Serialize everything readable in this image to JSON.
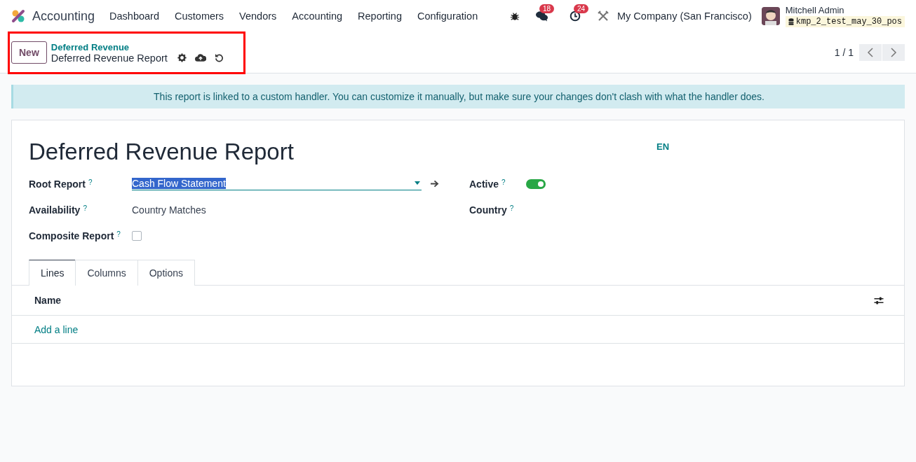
{
  "navbar": {
    "app": "Accounting",
    "menu": [
      "Dashboard",
      "Customers",
      "Vendors",
      "Accounting",
      "Reporting",
      "Configuration"
    ],
    "messages_count": "18",
    "activities_count": "24",
    "company": "My Company (San Francisco)",
    "user": "Mitchell Admin",
    "database": "kmp_2_test_may_30_pos"
  },
  "control_panel": {
    "new_button": "New",
    "breadcrumb_parent": "Deferred Revenue",
    "breadcrumb_current": "Deferred Revenue Report",
    "highlighted": true,
    "pager": "1 / 1"
  },
  "alert": "This report is linked to a custom handler. You can customize it manually, but make sure your changes don't clash with what the handler does.",
  "form": {
    "title": "Deferred Revenue Report",
    "language": "EN",
    "left_fields": [
      {
        "label": "Root Report",
        "help": "?",
        "kind": "many2one",
        "value": "Cash Flow Statement",
        "selected_text": true
      },
      {
        "label": "Availability",
        "help": "?",
        "kind": "text",
        "value": "Country Matches"
      },
      {
        "label": "Composite Report",
        "help": "?",
        "kind": "checkbox",
        "checked": false
      }
    ],
    "right_fields": [
      {
        "label": "Active",
        "help": "?",
        "kind": "toggle",
        "on": true
      },
      {
        "label": "Country",
        "help": "?",
        "kind": "empty"
      }
    ],
    "tabs": [
      {
        "label": "Lines",
        "selected": true
      },
      {
        "label": "Columns",
        "selected": false
      },
      {
        "label": "Options",
        "selected": false
      }
    ],
    "table": {
      "columns": [
        "Name"
      ],
      "add_line": "Add a line"
    }
  }
}
